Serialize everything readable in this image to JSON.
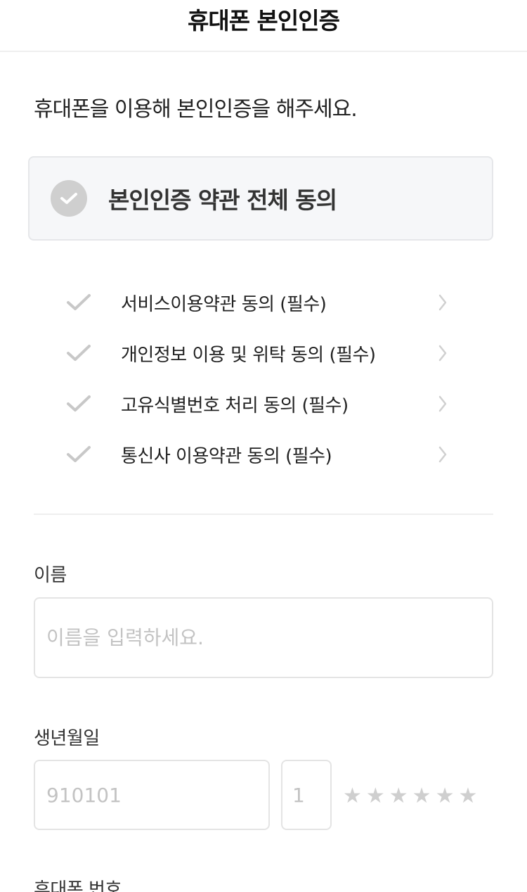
{
  "header": {
    "title": "휴대폰 본인인증"
  },
  "intro": {
    "text": "휴대폰을 이용해 본인인증을 해주세요."
  },
  "agree_all": {
    "label": "본인인증 약관 전체 동의",
    "checked": false
  },
  "terms": [
    {
      "label": "서비스이용약관 동의 (필수)"
    },
    {
      "label": "개인정보 이용 및 위탁 동의 (필수)"
    },
    {
      "label": "고유식별번호 처리 동의 (필수)"
    },
    {
      "label": "통신사 이용약관 동의 (필수)"
    }
  ],
  "form": {
    "name": {
      "label": "이름",
      "placeholder": "이름을 입력하세요."
    },
    "birth": {
      "label": "생년월일",
      "placeholder": "910101",
      "gender_placeholder": "1",
      "masked": "★★★★★★"
    },
    "phone": {
      "label": "휴대폰 번호"
    }
  },
  "colors": {
    "check_gray": "#cfcfcf",
    "box_bg": "#f6f7f9",
    "border": "#e4e4e4"
  }
}
